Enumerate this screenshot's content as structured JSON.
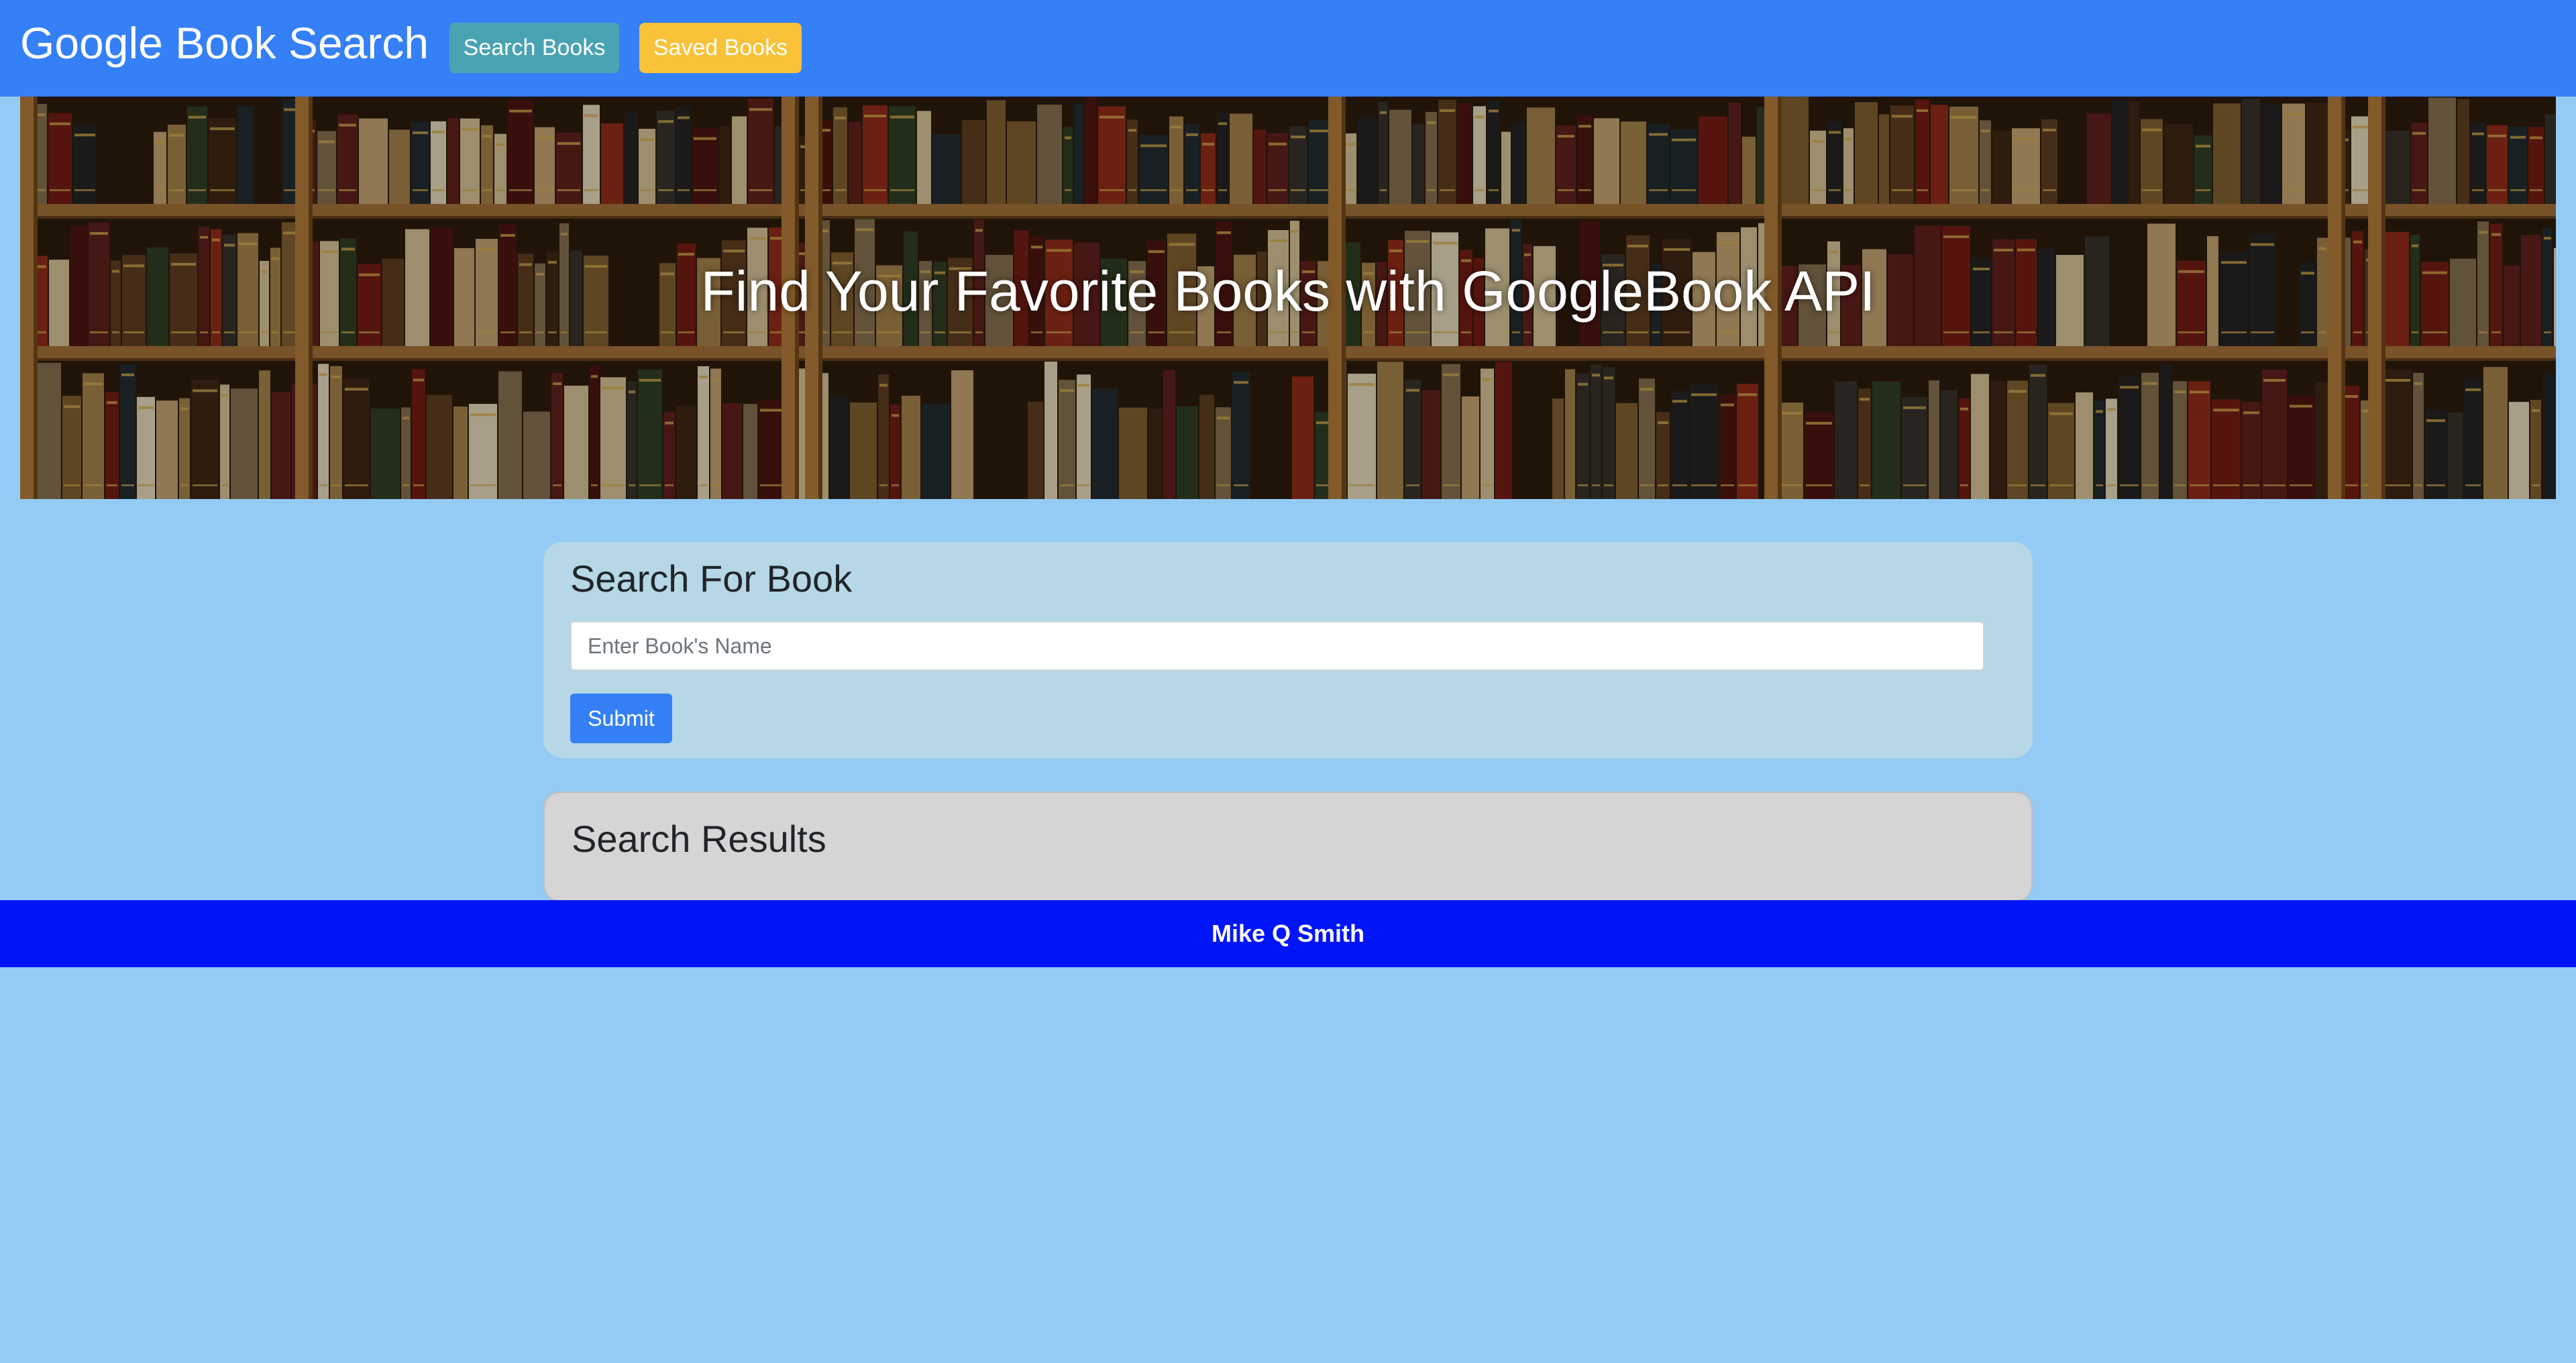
{
  "navbar": {
    "brand": "Google Book Search",
    "search_books_label": "Search Books",
    "saved_books_label": "Saved Books"
  },
  "hero": {
    "title": "Find Your Favorite Books with GoogleBook API"
  },
  "search": {
    "title": "Search For Book",
    "placeholder": "Enter Book's Name",
    "value": "",
    "submit_label": "Submit"
  },
  "results": {
    "title": "Search Results"
  },
  "footer": {
    "text": "Mike Q Smith"
  },
  "colors": {
    "navbar": "#3580f6",
    "page_background": "#94cbf4",
    "search_books_button": "#4aa3b3",
    "saved_books_button": "#f9c238",
    "search_card": "#b6d7e5",
    "results_card": "#d5d5d5",
    "footer": "#0015f7"
  }
}
